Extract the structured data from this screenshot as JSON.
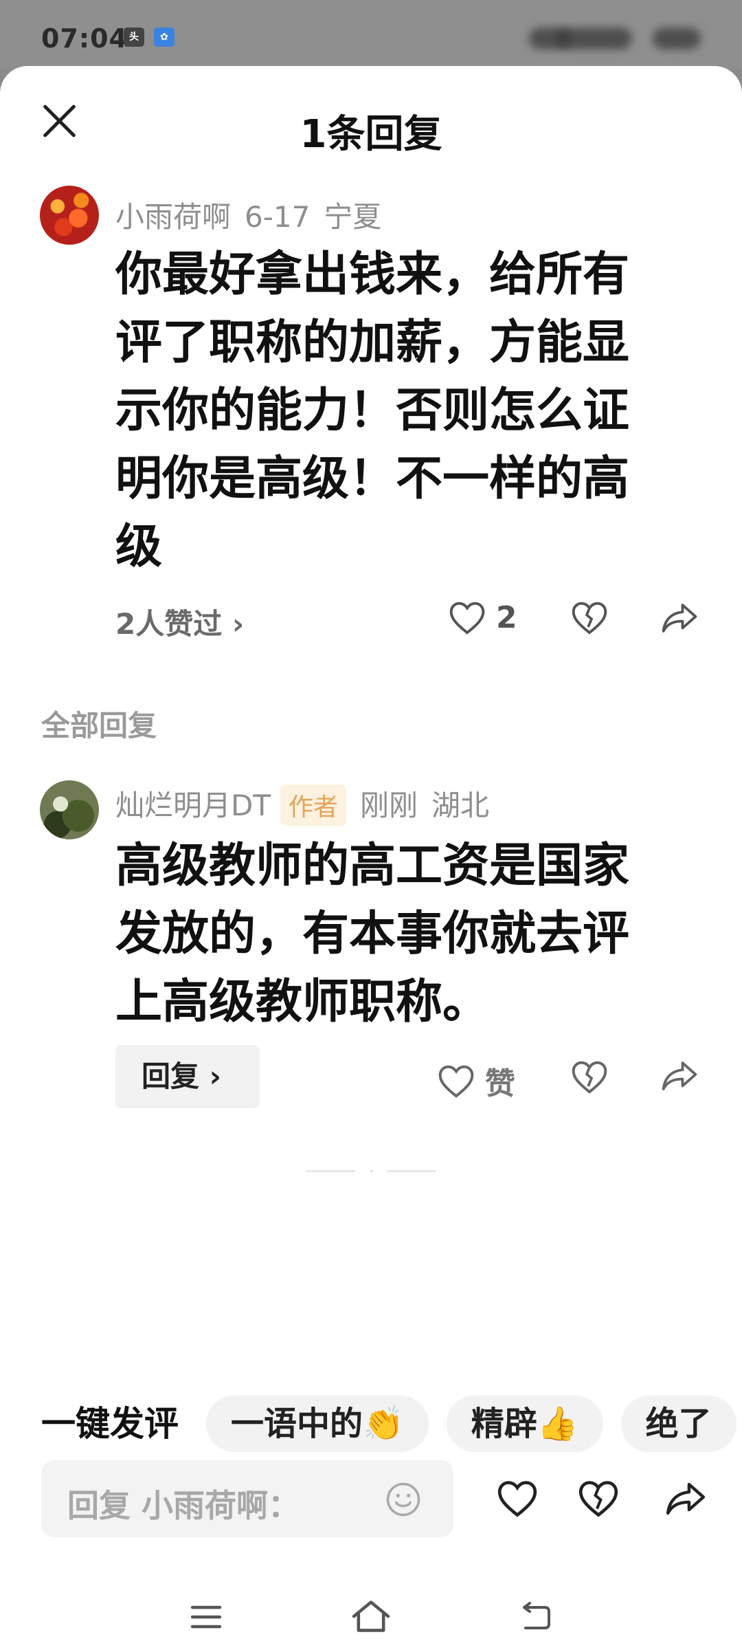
{
  "status_bar": {
    "time": "07:04",
    "icon_1": "头条",
    "icon_2": "Baidu"
  },
  "sheet": {
    "title": "1条回复"
  },
  "main_comment": {
    "author": "小雨荷啊",
    "date": "6-17",
    "location": "宁夏",
    "text": "你最好拿出钱来，给所有评了职称的加薪，方能显示你的能力！否则怎么证明你是高级！不一样的高级",
    "likers": "2人赞过",
    "like_count": "2"
  },
  "replies_section": {
    "label": "全部回复",
    "replies": [
      {
        "author": "灿烂明月DT",
        "author_badge": "作者",
        "time": "刚刚",
        "location": "湖北",
        "text": "高级教师的高工资是国家发放的，有本事你就去评上高级教师职称。",
        "reply_label": "回复",
        "like_label": "赞"
      }
    ]
  },
  "quick_reply": {
    "label": "一键发评",
    "chips": [
      "一语中的👏",
      "精辟👍",
      "绝了"
    ]
  },
  "input": {
    "placeholder": "回复 小雨荷啊："
  },
  "icons": {
    "close": "close-icon",
    "heart": "heart-icon",
    "broken_heart": "broken-heart-icon",
    "share": "share-icon",
    "emoji": "emoji-icon",
    "menu": "menu-icon",
    "home": "home-icon",
    "back": "back-icon"
  },
  "colors": {
    "author_badge_bg": "#fdf1df",
    "author_badge_text": "#e2a55a",
    "status_bar_bg": "#8f8f8f"
  }
}
